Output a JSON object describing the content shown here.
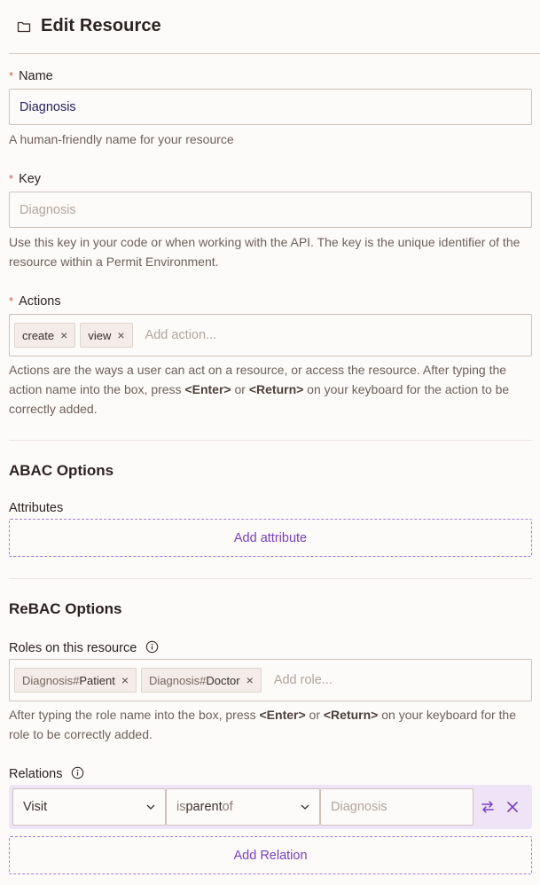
{
  "header": {
    "title": "Edit Resource",
    "icon": "folder-icon"
  },
  "name_field": {
    "required_mark": "*",
    "label": "Name",
    "value": "Diagnosis",
    "help": "A human-friendly name for your resource"
  },
  "key_field": {
    "required_mark": "*",
    "label": "Key",
    "placeholder": "Diagnosis",
    "help": "Use this key in your code or when working with the API. The key is the unique identifier of the resource within a Permit Environment."
  },
  "actions_field": {
    "required_mark": "*",
    "label": "Actions",
    "chips": [
      {
        "label": "create",
        "remove": "×"
      },
      {
        "label": "view",
        "remove": "×"
      }
    ],
    "placeholder": "Add action...",
    "help_part1": "Actions are the ways a user can act on a resource, or access the resource. After typing the action name into the box, press ",
    "help_key1": "<Enter>",
    "help_or": " or ",
    "help_key2": "<Return>",
    "help_part2": " on your keyboard for the action to be correctly added."
  },
  "abac": {
    "title": "ABAC Options",
    "attributes_label": "Attributes",
    "add_attribute_label": "Add attribute"
  },
  "rebac": {
    "title": "ReBAC Options",
    "roles_label": "Roles on this resource",
    "roles": [
      {
        "prefix": "Diagnosis#",
        "name": "Patient",
        "remove": "×"
      },
      {
        "prefix": "Diagnosis#",
        "name": "Doctor",
        "remove": "×"
      }
    ],
    "roles_placeholder": "Add role...",
    "roles_help_part1": "After typing the role name into the box, press ",
    "roles_help_key1": "<Enter>",
    "roles_help_or": " or ",
    "roles_help_key2": "<Return>",
    "roles_help_part2": " on your keyboard for the role to be correctly added.",
    "relations_label": "Relations",
    "relation": {
      "subject": "Visit",
      "relation_is": "is ",
      "relation_name": "parent",
      "relation_of": " of",
      "object_placeholder": "Diagnosis"
    },
    "add_relation_label": "Add Relation"
  },
  "colors": {
    "accent": "#7b3fc6",
    "required": "#d05a4a",
    "relation_bg": "#efe4f7"
  }
}
